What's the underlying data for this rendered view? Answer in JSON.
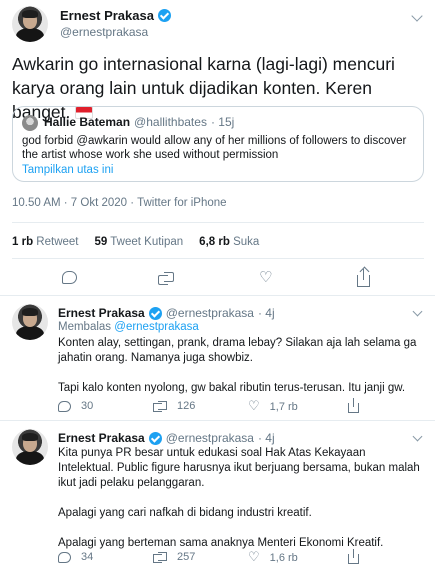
{
  "main_tweet": {
    "author_name": "Ernest Prakasa",
    "author_handle": "@ernestprakasa",
    "text": "Awkarin go internasional karna (lagi-lagi) mencuri karya orang lain untuk dijadikan konten. Keren banget.",
    "flag_icon": "indonesia-flag-icon",
    "quoted": {
      "author_name": "Hallie Bateman",
      "author_handle": "@hallithbates",
      "time": "· 15j",
      "text": "god forbid @awkarin would allow any of her millions of followers to discover the artist whose work she used without permission",
      "thread_link": "Tampilkan utas ini"
    },
    "timestamp": "10.50 AM · 7 Okt 2020 · Twitter for iPhone",
    "stats": {
      "retweets_count": "1 rb",
      "retweets_label": "Retweet",
      "quotes_count": "59",
      "quotes_label": "Tweet Kutipan",
      "likes_count": "6,8 rb",
      "likes_label": "Suka"
    }
  },
  "replies": [
    {
      "author_name": "Ernest Prakasa",
      "author_handle": "@ernestprakasa",
      "time": "· 4j",
      "replying_prefix": "Membalas",
      "replying_to": "@ernestprakasa",
      "text": "Konten alay, settingan, prank, drama lebay? Silakan aja lah selama ga jahatin orang. Namanya juga showbiz.\n\nTapi kalo konten nyolong, gw bakal ributin terus-terusan. Itu janji gw.",
      "reply_count": "30",
      "retweet_count": "126",
      "like_count": "1,7 rb"
    },
    {
      "author_name": "Ernest Prakasa",
      "author_handle": "@ernestprakasa",
      "time": "· 4j",
      "text": "Kita punya PR besar untuk edukasi soal Hak Atas Kekayaan Intelektual. Public figure harusnya ikut berjuang bersama, bukan malah ikut jadi pelaku pelanggaran.\n\nApalagi yang cari nafkah di bidang industri kreatif.\n\nApalagi yang berteman sama anaknya Menteri Ekonomi Kreatif.",
      "reply_count": "34",
      "retweet_count": "257",
      "like_count": "1,6 rb"
    }
  ],
  "colors": {
    "accent": "#1da1f2",
    "secondary_text": "#657786",
    "border": "#e6ecf0"
  }
}
